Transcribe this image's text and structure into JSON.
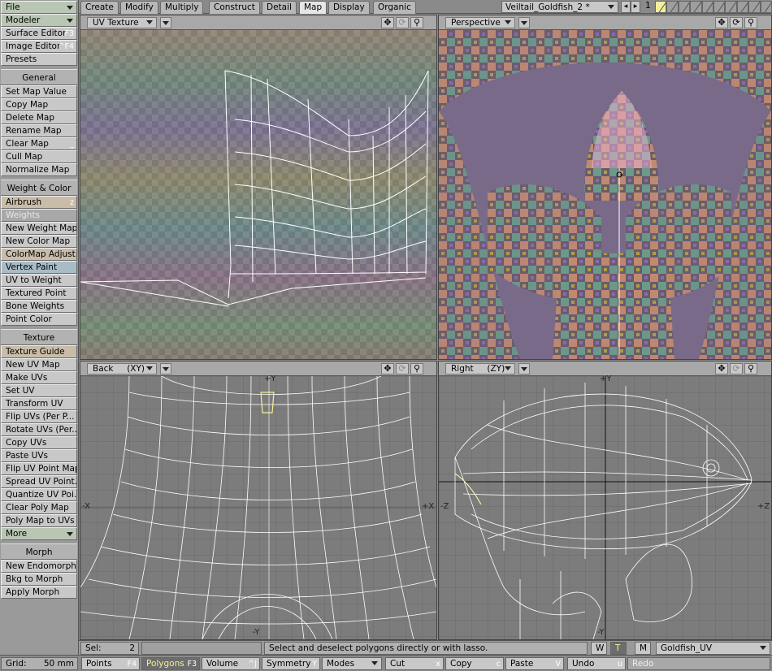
{
  "sidebar": {
    "file": "File",
    "modeler": "Modeler",
    "surface_editor": {
      "label": "Surface Editor",
      "shortcut": "F3"
    },
    "image_editor": {
      "label": "Image Editor",
      "shortcut": "^F4"
    },
    "presets": "Presets",
    "general_header": "General",
    "general": [
      "Set Map Value",
      "Copy Map",
      "Delete Map",
      "Rename Map",
      "Clear Map",
      "Cull Map",
      "Normalize Map"
    ],
    "clear_map_shortcut": "_",
    "weight_color_header": "Weight & Color",
    "airbrush": {
      "label": "Airbrush",
      "shortcut": "z"
    },
    "weights": "Weights",
    "weight_color": [
      "New Weight Map",
      "New Color Map",
      "ColorMap Adjust...",
      "Vertex Paint",
      "UV to Weight",
      "Textured Point",
      "Bone Weights",
      "Point Color"
    ],
    "texture_header": "Texture",
    "texture_guide": "Texture Guide",
    "texture": [
      "New UV Map",
      "Make UVs",
      "Set UV",
      "Transform UV",
      "Flip UVs (Per P...",
      "Rotate UVs (Per...",
      "Copy UVs",
      "Paste UVs",
      "Flip UV Point Map",
      "Spread UV Point...",
      "Quantize UV Poi...",
      "Clear Poly Map",
      "Poly Map to UVs"
    ],
    "more": "More",
    "morph_header": "Morph",
    "morph": [
      "New Endomorph",
      "Bkg to Morph",
      "Apply Morph"
    ],
    "grid_label": "Grid:",
    "grid_value": "50 mm"
  },
  "tabs": [
    "Create",
    "Modify",
    "Multiply",
    "Construct",
    "Detail",
    "Map",
    "Display",
    "Organic"
  ],
  "active_tab": "Map",
  "scene": "Veiltail_Goldfish_2 *",
  "layer_number": "1",
  "viewports": {
    "uv": {
      "title": "UV Texture"
    },
    "persp": {
      "title": "Perspective"
    },
    "back": {
      "title": "Back",
      "plane": "(XY)",
      "top": "+Y",
      "bottom": "-Y",
      "left": "-X",
      "right": "+X"
    },
    "right": {
      "title": "Right",
      "plane": "(ZY)",
      "top": "+Y",
      "bottom": "-Y",
      "left": "-Z",
      "right": "+Z"
    }
  },
  "status": {
    "sel_label": "Sel:",
    "sel_value": "2",
    "message": "Select and deselect polygons directly or with lasso.",
    "w": "W",
    "t": "T",
    "m": "M",
    "map": "Goldfish_UV"
  },
  "bottom": {
    "points": {
      "label": "Points",
      "shortcut": "F4"
    },
    "polygons": {
      "label": "Polygons",
      "shortcut": "F3"
    },
    "volume": {
      "label": "Volume",
      "shortcut": "^J"
    },
    "symmetry": {
      "label": "Symmetry",
      "shortcut": "Y"
    },
    "modes": "Modes",
    "cut": {
      "label": "Cut",
      "shortcut": "x"
    },
    "copy": {
      "label": "Copy",
      "shortcut": "c"
    },
    "paste": {
      "label": "Paste",
      "shortcut": "V"
    },
    "undo": {
      "label": "Undo",
      "shortcut": "u"
    },
    "redo": "Redo"
  },
  "colors": {
    "highlight": "#f4ee9a",
    "wire": "#ffffff",
    "grid": "#6a6a6a"
  }
}
